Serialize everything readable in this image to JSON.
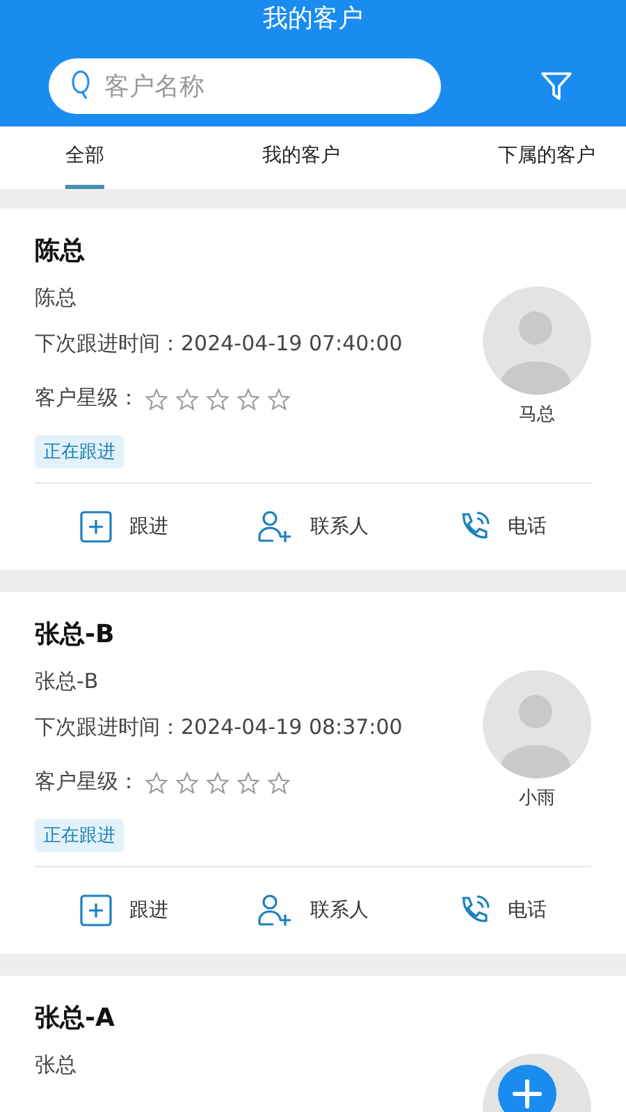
{
  "header": {
    "title": "我的客户",
    "search": {
      "placeholder": "客户名称"
    }
  },
  "tabs": [
    {
      "label": "全部",
      "selected": true
    },
    {
      "label": "我的客户",
      "selected": false
    },
    {
      "label": "下属的客户",
      "selected": false
    }
  ],
  "customers": [
    {
      "name": "陈总",
      "contact": "陈总",
      "next_follow": "下次跟进时间：2024-04-19 07:40:00",
      "rating_label": "客户星级：",
      "stars": 0,
      "status": "正在跟进",
      "owner": "马总",
      "actions": [
        "跟进",
        "联系人",
        "电话"
      ]
    },
    {
      "name": "张总-B",
      "contact": "张总-B",
      "next_follow": "下次跟进时间：2024-04-19 08:37:00",
      "rating_label": "客户星级：",
      "stars": 0,
      "status": "正在跟进",
      "owner": "小雨",
      "actions": [
        "跟进",
        "联系人",
        "电话"
      ]
    },
    {
      "name": "张总-A",
      "contact": "张总"
    }
  ]
}
